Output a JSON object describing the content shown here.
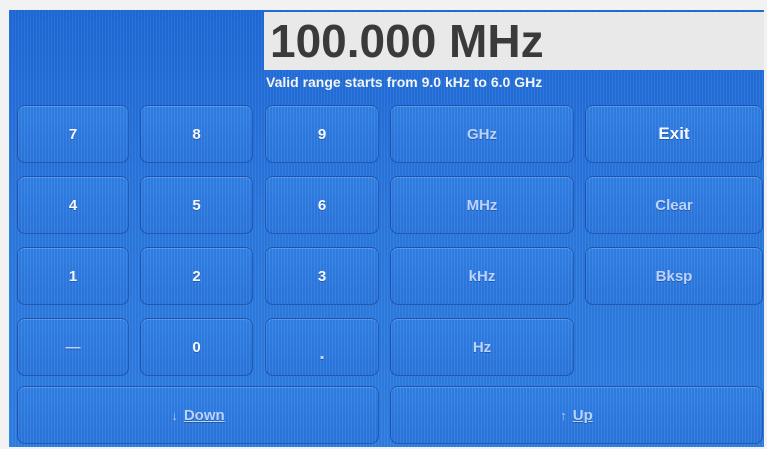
{
  "readout": {
    "value": "100.000 MHz"
  },
  "hint": "Valid range starts from 9.0 kHz to 6.0 GHz",
  "keypad": {
    "k7": "7",
    "k8": "8",
    "k9": "9",
    "k4": "4",
    "k5": "5",
    "k6": "6",
    "k1": "1",
    "k2": "2",
    "k3": "3",
    "kminus": "—",
    "k0": "0",
    "kdot": "."
  },
  "units": {
    "ghz": "GHz",
    "mhz": "MHz",
    "khz": "kHz",
    "hz": "Hz"
  },
  "actions": {
    "exit": "Exit",
    "clear": "Clear",
    "bksp": "Bksp"
  },
  "nav": {
    "down_label": "Down",
    "down_icon": "arrow-down-icon",
    "up_label": "Up",
    "up_icon": "arrow-up-icon"
  }
}
